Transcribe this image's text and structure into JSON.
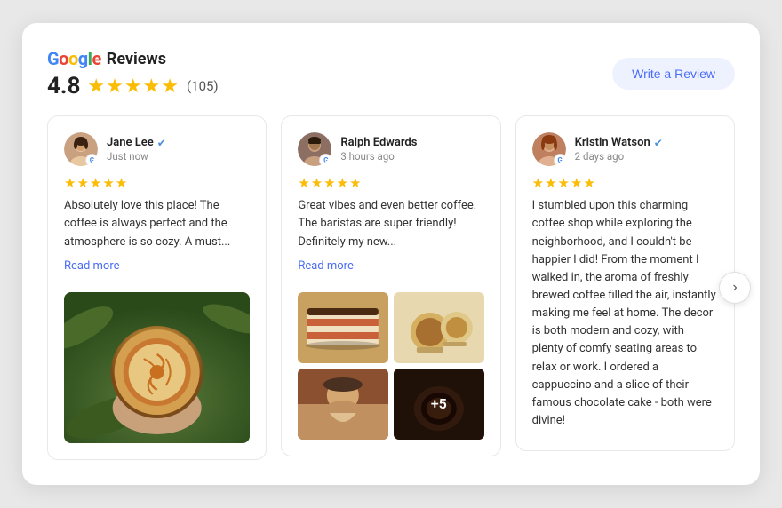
{
  "header": {
    "google_text": "Google",
    "reviews_text": "Reviews",
    "rating": "4.8",
    "review_count": "(105)",
    "write_review_label": "Write a Review"
  },
  "reviews": [
    {
      "id": "jane-lee",
      "name": "Jane Lee",
      "verified": true,
      "time": "Just now",
      "stars": 5,
      "text": "Absolutely love this place! The coffee is always perfect and the atmosphere is so cozy. A must...",
      "read_more": "Read more",
      "has_image": true,
      "image_type": "latte"
    },
    {
      "id": "ralph-edwards",
      "name": "Ralph Edwards",
      "verified": false,
      "time": "3 hours ago",
      "stars": 5,
      "text": "Great vibes and even better coffee. The baristas are super friendly! Definitely my new...",
      "read_more": "Read more",
      "has_image": true,
      "image_type": "grid"
    },
    {
      "id": "kristin-watson",
      "name": "Kristin Watson",
      "verified": true,
      "time": "2 days ago",
      "stars": 5,
      "text": "I stumbled upon this charming coffee shop while exploring the neighborhood, and I couldn't be happier I did! From the moment I walked in, the aroma of freshly brewed coffee filled the air, instantly making me feel at home. The decor is both modern and cozy, with plenty of comfy seating areas to relax or work. I ordered a cappuccino and a slice of their famous chocolate cake - both were divine!",
      "read_more": null,
      "has_image": false,
      "image_type": null
    }
  ],
  "grid_images": {
    "extra_count": "+5"
  }
}
